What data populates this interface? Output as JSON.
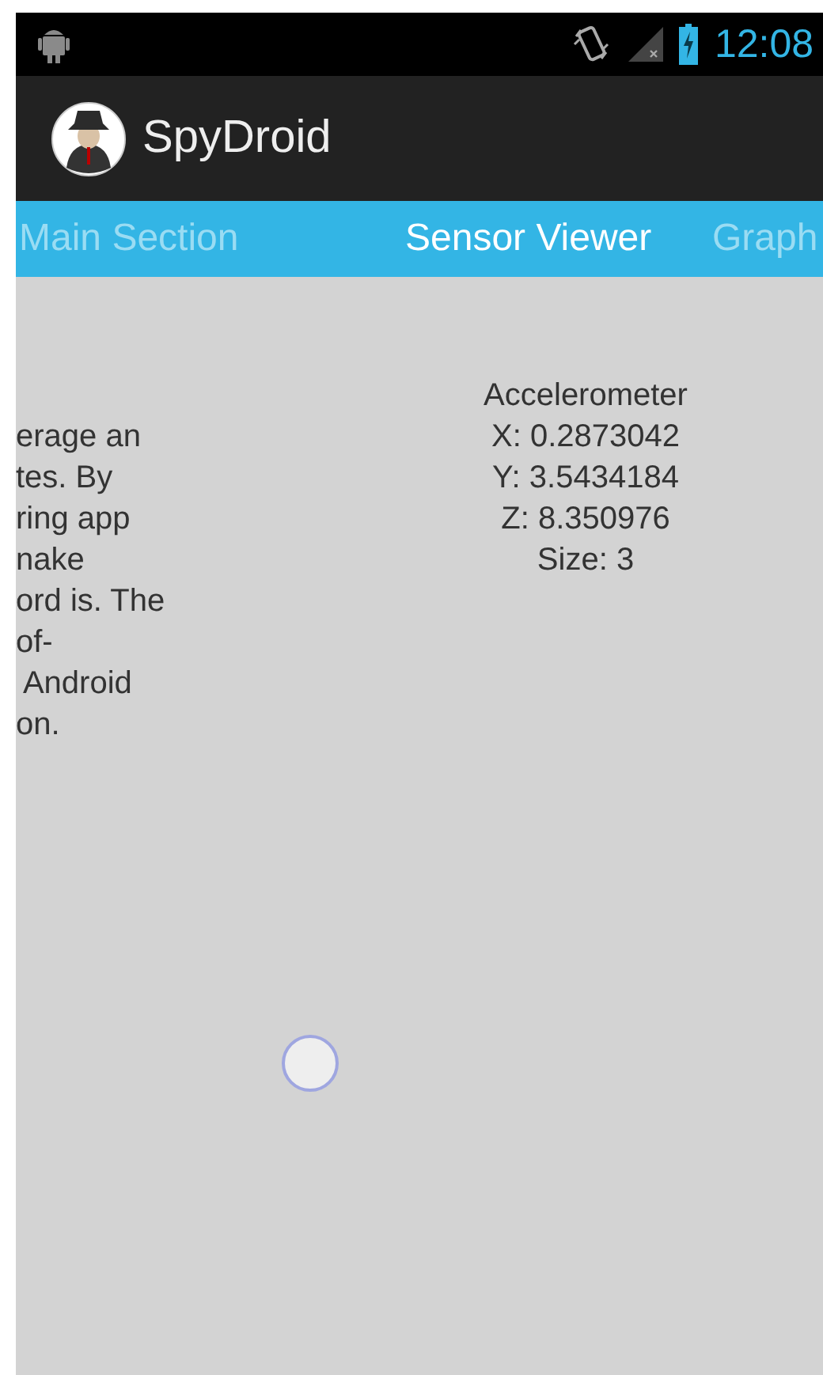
{
  "status_bar": {
    "time": "12:08"
  },
  "action_bar": {
    "title": "SpyDroid"
  },
  "tabs": [
    {
      "label": "Main Section",
      "selected": false
    },
    {
      "label": "Sensor Viewer",
      "selected": true
    },
    {
      "label": "Graph",
      "selected": false
    }
  ],
  "left_text_lines": [
    "erage an",
    "tes. By",
    "ring app",
    "nake",
    "ord is. The",
    "of-",
    " Android",
    "on."
  ],
  "sensor": {
    "lines": [
      "Accelerometer",
      "X: 0.2873042",
      "Y: 3.5434184",
      "Z: 8.350976",
      "Size: 3"
    ]
  }
}
